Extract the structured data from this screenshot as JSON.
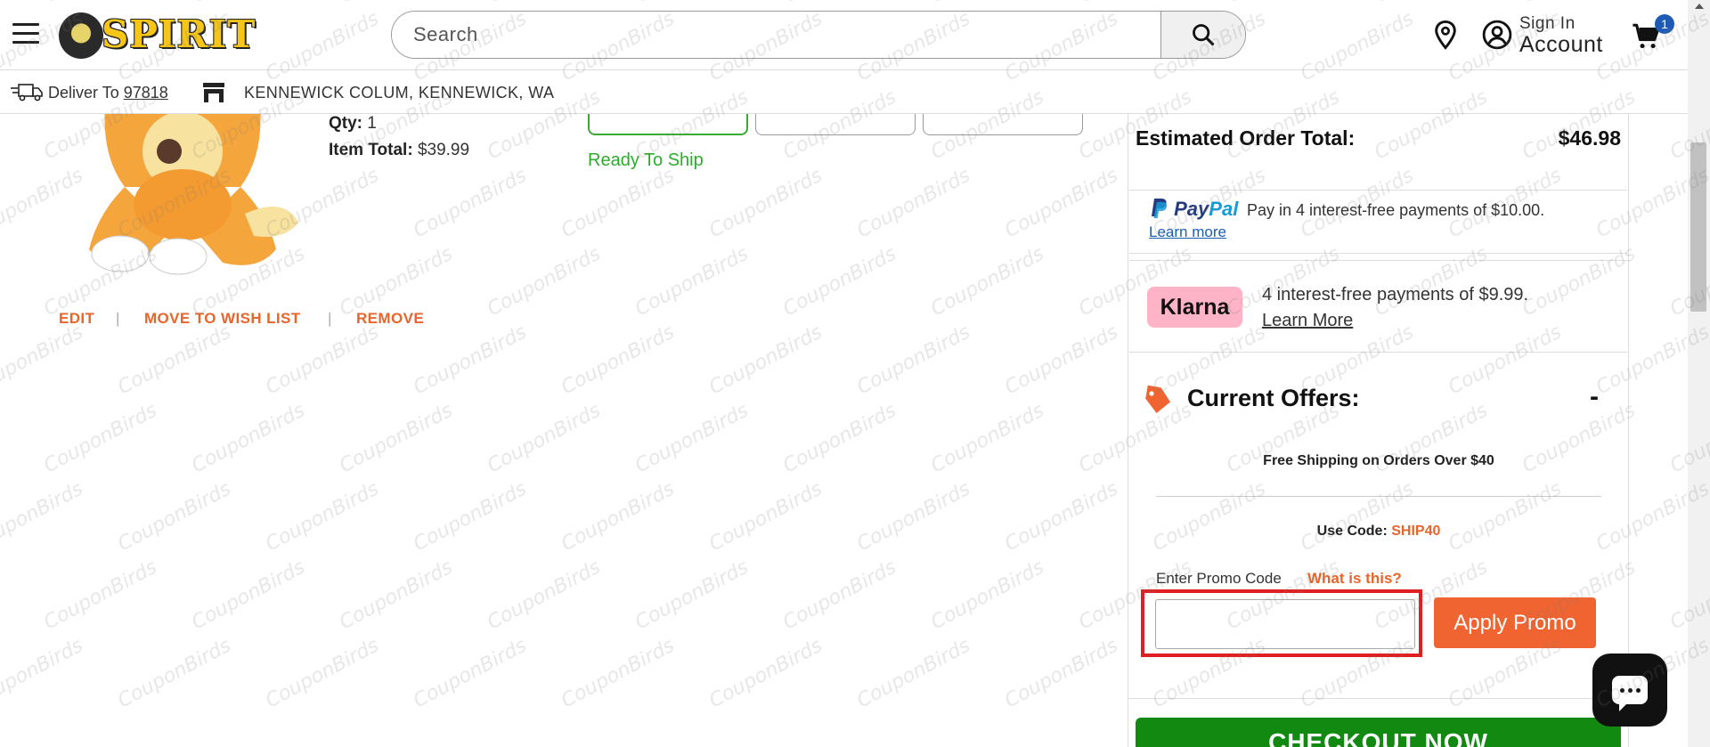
{
  "header": {
    "logo_text": "SPIRIT",
    "search_placeholder": "Search",
    "account_line1": "Sign In",
    "account_line2": "Account",
    "cart_count": "1"
  },
  "subheader": {
    "deliver_label": "Deliver To",
    "zip": "97818",
    "store_name": "KENNEWICK COLUM, KENNEWICK, WA"
  },
  "item": {
    "qty_label": "Qty:",
    "qty_value": "1",
    "total_label": "Item Total:",
    "total_value": "$39.99",
    "availability": "Ready To Ship",
    "actions": [
      "EDIT",
      "MOVE TO WISH LIST",
      "REMOVE"
    ]
  },
  "summary": {
    "estimated_label": "Estimated Order Total:",
    "estimated_value": "$46.98",
    "paypal_brand_a": "Pay",
    "paypal_brand_b": "Pal",
    "paypal_text": "Pay in 4 interest-free payments of $10.00.",
    "paypal_learn": "Learn more",
    "klarna_brand": "Klarna",
    "klarna_text": "4 interest-free payments of $9.99.",
    "klarna_learn": "Learn More",
    "offers_title": "Current Offers:",
    "offers_toggle": "-",
    "offer_text": "Free Shipping on Orders Over $40",
    "use_code_label": "Use Code:",
    "use_code_value": "SHIP40",
    "promo_label": "Enter Promo Code",
    "promo_what": "What is this?",
    "promo_value": "",
    "apply_label": "Apply Promo",
    "checkout_label": "CHECKOUT NOW"
  },
  "watermark": "CouponBirds",
  "colors": {
    "accent_orange": "#e8652b",
    "apply_button": "#ef6431",
    "checkout_green": "#128a12",
    "ready_green": "#2bad2b",
    "klarna_pink": "#ffb3c7",
    "cart_badge": "#1f5bb5",
    "highlight_red": "#e02020"
  },
  "icons": [
    "hamburger-icon",
    "search-icon",
    "location-pin-icon",
    "account-icon",
    "cart-icon",
    "truck-icon",
    "store-icon",
    "tag-icon",
    "chat-icon"
  ]
}
